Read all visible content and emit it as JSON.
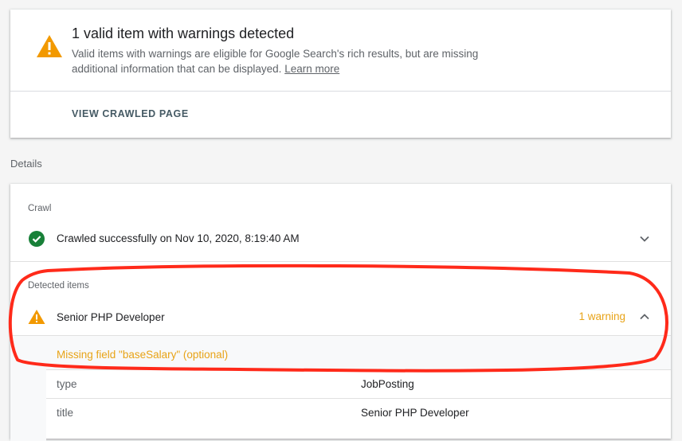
{
  "summary": {
    "title": "1 valid item with warnings detected",
    "description": "Valid items with warnings are eligible for Google Search's rich results, but are missing additional information that can be displayed.",
    "learn_more": "Learn more",
    "view_button": "VIEW CRAWLED PAGE",
    "icon": "warning-icon"
  },
  "details_heading": "Details",
  "crawl": {
    "label": "Crawl",
    "status": "Crawled successfully on Nov 10, 2020, 8:19:40 AM",
    "icon": "check-circle-icon"
  },
  "detected": {
    "label": "Detected items",
    "item_name": "Senior PHP Developer",
    "warning_count": "1 warning",
    "missing_field": "Missing field \"baseSalary\" (optional)",
    "properties": [
      {
        "key": "type",
        "value": "JobPosting"
      },
      {
        "key": "title",
        "value": "Senior PHP Developer"
      }
    ]
  },
  "colors": {
    "warning": "#f29900",
    "warning_text": "#e8a317",
    "success": "#188038",
    "annotation": "#ff2a1a"
  }
}
